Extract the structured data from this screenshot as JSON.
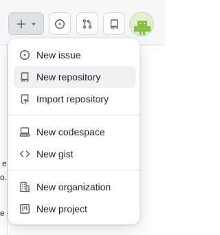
{
  "header": {
    "create_icon": "plus-icon",
    "caret_icon": "triangle-down-icon",
    "issues_icon": "issue-opened-icon",
    "pulls_icon": "git-pull-request-icon",
    "inbox_icon": "repo-icon",
    "avatar_icon": "android-avatar"
  },
  "background": {
    "lines": [
      "e su",
      "o...",
      "e c"
    ]
  },
  "menu": {
    "items": [
      {
        "label": "New issue",
        "icon": "issue-opened-icon"
      },
      {
        "label": "New repository",
        "icon": "repo-icon",
        "active": true
      },
      {
        "label": "Import repository",
        "icon": "repo-push-icon"
      },
      {
        "label": "New codespace",
        "icon": "codespaces-icon"
      },
      {
        "label": "New gist",
        "icon": "code-icon"
      },
      {
        "label": "New organization",
        "icon": "organization-icon"
      },
      {
        "label": "New project",
        "icon": "project-icon"
      }
    ]
  },
  "colors": {
    "text": "#1f2328",
    "icon": "#59636e",
    "active_bg": "#eef0f2",
    "border": "#d1d9e0"
  }
}
